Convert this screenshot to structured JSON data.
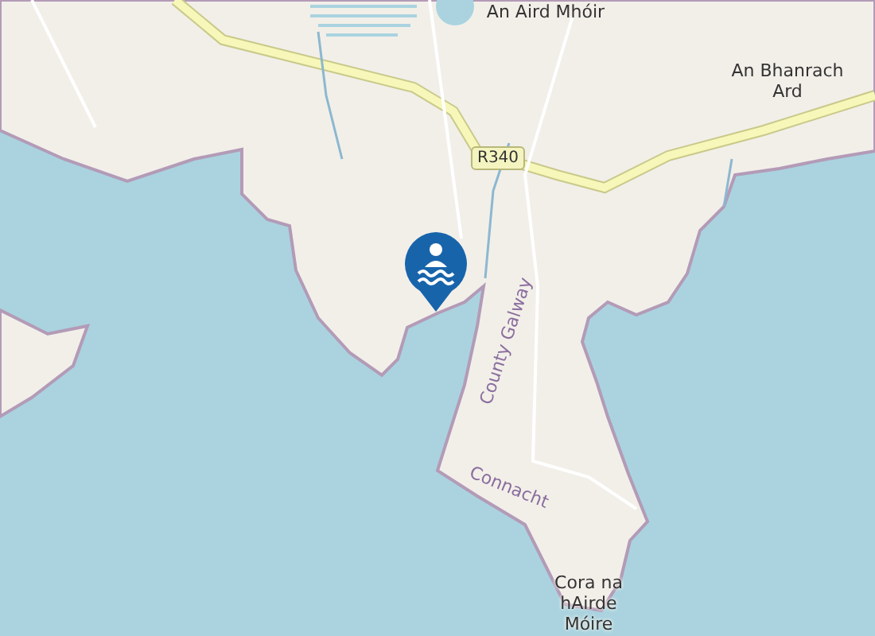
{
  "map": {
    "places": [
      {
        "name": "An Aird Mhóir"
      },
      {
        "name": "An Bhanrach Ard"
      },
      {
        "name": "Cora na hAirde Móire"
      }
    ],
    "regions": [
      {
        "name": "County Galway"
      },
      {
        "name": "Connacht"
      }
    ],
    "road_shields": [
      {
        "text": "R340"
      }
    ]
  }
}
